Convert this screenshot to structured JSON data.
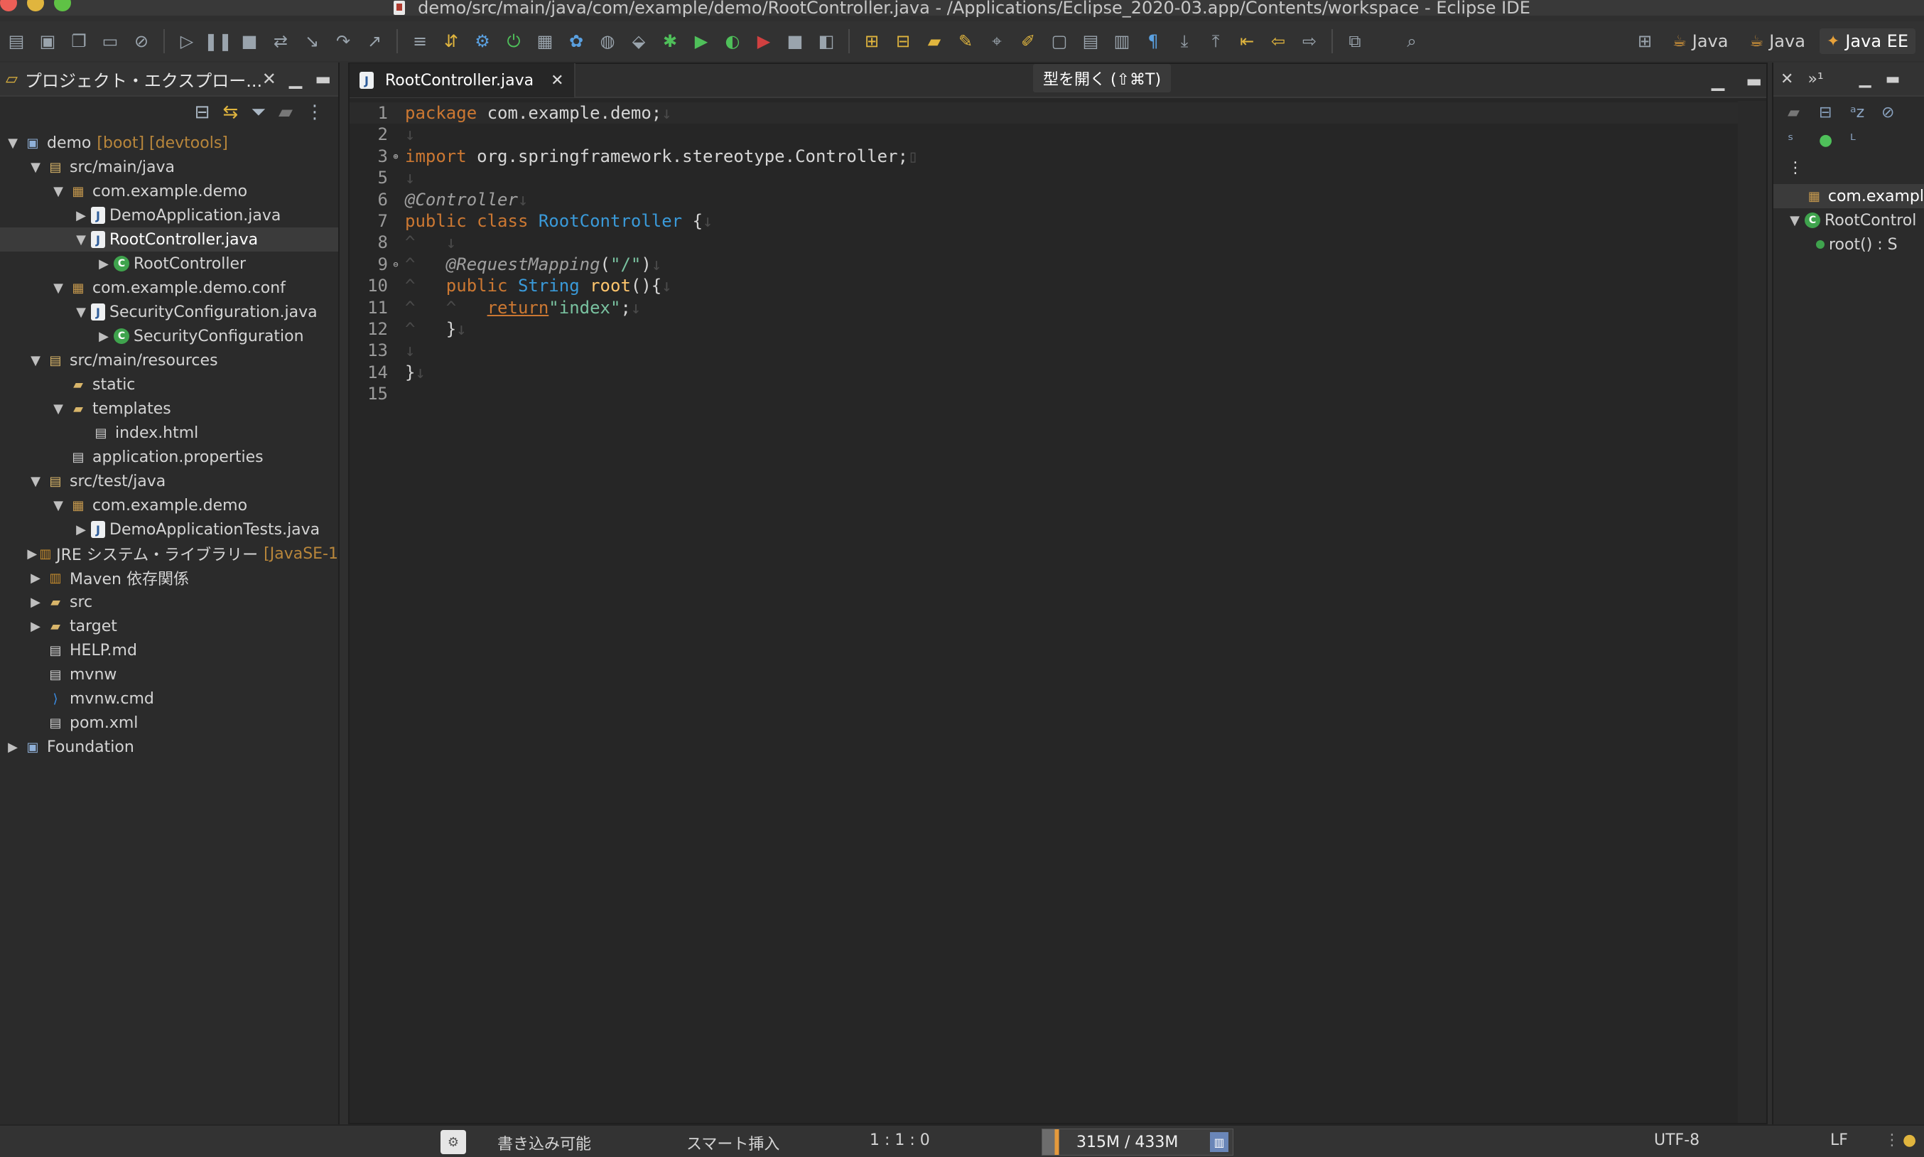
{
  "window": {
    "title": "demo/src/main/java/com/example/demo/RootController.java - /Applications/Eclipse_2020-03.app/Contents/workspace - Eclipse IDE"
  },
  "perspectives": [
    {
      "label": "Java",
      "icon": "java-perspective-icon"
    },
    {
      "label": "Java",
      "icon": "java-browsing-icon"
    },
    {
      "label": "Java EE",
      "icon": "java-ee-perspective-icon",
      "active": true
    }
  ],
  "explorer": {
    "title": "プロジェクト・エクスプロー...",
    "tree": [
      {
        "label": "demo",
        "tag": "[boot] [devtools]",
        "icon": "project",
        "twisty": "▼",
        "depth": 0
      },
      {
        "label": "src/main/java",
        "icon": "srcfolder",
        "twisty": "▼",
        "depth": 1
      },
      {
        "label": "com.example.demo",
        "icon": "package",
        "twisty": "▼",
        "depth": 2
      },
      {
        "label": "DemoApplication.java",
        "icon": "java",
        "twisty": "▶",
        "depth": 3
      },
      {
        "label": "RootController.java",
        "icon": "java",
        "twisty": "▼",
        "depth": 3,
        "selected": true
      },
      {
        "label": "RootController",
        "icon": "class",
        "twisty": "▶",
        "depth": 4
      },
      {
        "label": "com.example.demo.conf",
        "icon": "package",
        "twisty": "▼",
        "depth": 2
      },
      {
        "label": "SecurityConfiguration.java",
        "icon": "java",
        "twisty": "▼",
        "depth": 3
      },
      {
        "label": "SecurityConfiguration",
        "icon": "class",
        "twisty": "▶",
        "depth": 4
      },
      {
        "label": "src/main/resources",
        "icon": "srcfolder",
        "twisty": "▼",
        "depth": 1
      },
      {
        "label": "static",
        "icon": "folder",
        "twisty": "",
        "depth": 2
      },
      {
        "label": "templates",
        "icon": "folder",
        "twisty": "▼",
        "depth": 2
      },
      {
        "label": "index.html",
        "icon": "file",
        "twisty": "",
        "depth": 3
      },
      {
        "label": "application.properties",
        "icon": "file",
        "twisty": "",
        "depth": 2
      },
      {
        "label": "src/test/java",
        "icon": "srcfolder",
        "twisty": "▼",
        "depth": 1
      },
      {
        "label": "com.example.demo",
        "icon": "package",
        "twisty": "▼",
        "depth": 2
      },
      {
        "label": "DemoApplicationTests.java",
        "icon": "java",
        "twisty": "▶",
        "depth": 3
      },
      {
        "label": "JRE システム・ライブラリー",
        "tag": "[JavaSE-1",
        "icon": "lib",
        "twisty": "▶",
        "depth": 1
      },
      {
        "label": "Maven 依存関係",
        "icon": "lib",
        "twisty": "▶",
        "depth": 1
      },
      {
        "label": "src",
        "icon": "folder",
        "twisty": "▶",
        "depth": 1
      },
      {
        "label": "target",
        "icon": "folder",
        "twisty": "▶",
        "depth": 1
      },
      {
        "label": "HELP.md",
        "icon": "file",
        "twisty": "",
        "depth": 1
      },
      {
        "label": "mvnw",
        "icon": "file",
        "twisty": "",
        "depth": 1
      },
      {
        "label": "mvnw.cmd",
        "icon": "vscode",
        "twisty": "",
        "depth": 1
      },
      {
        "label": "pom.xml",
        "icon": "file",
        "twisty": "",
        "depth": 1
      },
      {
        "label": "Foundation",
        "icon": "project",
        "twisty": "▶",
        "depth": 0
      }
    ]
  },
  "editor": {
    "tab_label": "RootController.java",
    "tooltip": "型を開く (⇧⌘T)",
    "lines": [
      {
        "no": "1",
        "fold": "",
        "tokens": [
          [
            "kw",
            "package"
          ],
          [
            "plain",
            " com.example.demo;"
          ],
          [
            "ws",
            "↓"
          ]
        ]
      },
      {
        "no": "2",
        "fold": "",
        "tokens": [
          [
            "ws",
            "↓"
          ]
        ]
      },
      {
        "no": "3",
        "fold": "⊕",
        "tokens": [
          [
            "kw",
            "import"
          ],
          [
            "plain",
            " org.springframework.stereotype.Controller;"
          ],
          [
            "ws",
            "▯"
          ]
        ]
      },
      {
        "no": "5",
        "fold": "",
        "tokens": [
          [
            "ws",
            "↓"
          ]
        ]
      },
      {
        "no": "6",
        "fold": "",
        "tokens": [
          [
            "ann",
            "@Controller"
          ],
          [
            "ws",
            "↓"
          ]
        ]
      },
      {
        "no": "7",
        "fold": "",
        "tokens": [
          [
            "kw",
            "public class "
          ],
          [
            "typ",
            "RootController"
          ],
          [
            "plain",
            " {"
          ],
          [
            "ws",
            "↓"
          ]
        ]
      },
      {
        "no": "8",
        "fold": "",
        "tokens": [
          [
            "ws",
            "^   ↓"
          ]
        ]
      },
      {
        "no": "9",
        "fold": "⊖",
        "tokens": [
          [
            "ws",
            "^   "
          ],
          [
            "ann",
            "@RequestMapping"
          ],
          [
            "plain",
            "("
          ],
          [
            "str",
            "\"/\""
          ],
          [
            "plain",
            ")"
          ],
          [
            "ws",
            "↓"
          ]
        ]
      },
      {
        "no": "10",
        "fold": "",
        "tokens": [
          [
            "ws",
            "^   "
          ],
          [
            "kw",
            "public "
          ],
          [
            "typ",
            "String "
          ],
          [
            "meth",
            "root"
          ],
          [
            "plain",
            "(){"
          ],
          [
            "ws",
            "↓"
          ]
        ]
      },
      {
        "no": "11",
        "fold": "",
        "tokens": [
          [
            "ws",
            "^   ^   "
          ],
          [
            "ret",
            "return"
          ],
          [
            "str",
            "\"index\""
          ],
          [
            "plain",
            ";"
          ],
          [
            "ws",
            "↓"
          ]
        ]
      },
      {
        "no": "12",
        "fold": "",
        "tokens": [
          [
            "ws",
            "^   "
          ],
          [
            "plain",
            "}"
          ],
          [
            "ws",
            "↓"
          ]
        ]
      },
      {
        "no": "13",
        "fold": "",
        "tokens": [
          [
            "ws",
            "↓"
          ]
        ]
      },
      {
        "no": "14",
        "fold": "",
        "tokens": [
          [
            "plain",
            "}"
          ],
          [
            "ws",
            "↓"
          ]
        ]
      },
      {
        "no": "15",
        "fold": "",
        "tokens": []
      }
    ]
  },
  "outline": {
    "items": [
      {
        "label": "com.exampl",
        "icon": "package",
        "twisty": "",
        "selected": true
      },
      {
        "label": "RootControl",
        "icon": "class",
        "twisty": "▼"
      },
      {
        "label": "root() : S",
        "icon": "method",
        "twisty": ""
      }
    ]
  },
  "status": {
    "writable": "書き込み可能",
    "insert_mode": "スマート挿入",
    "position": "1 : 1 : 0",
    "heap": "315M / 433M",
    "heap_used_fraction": 0.727,
    "encoding": "UTF-8",
    "line_delimiter": "LF"
  }
}
